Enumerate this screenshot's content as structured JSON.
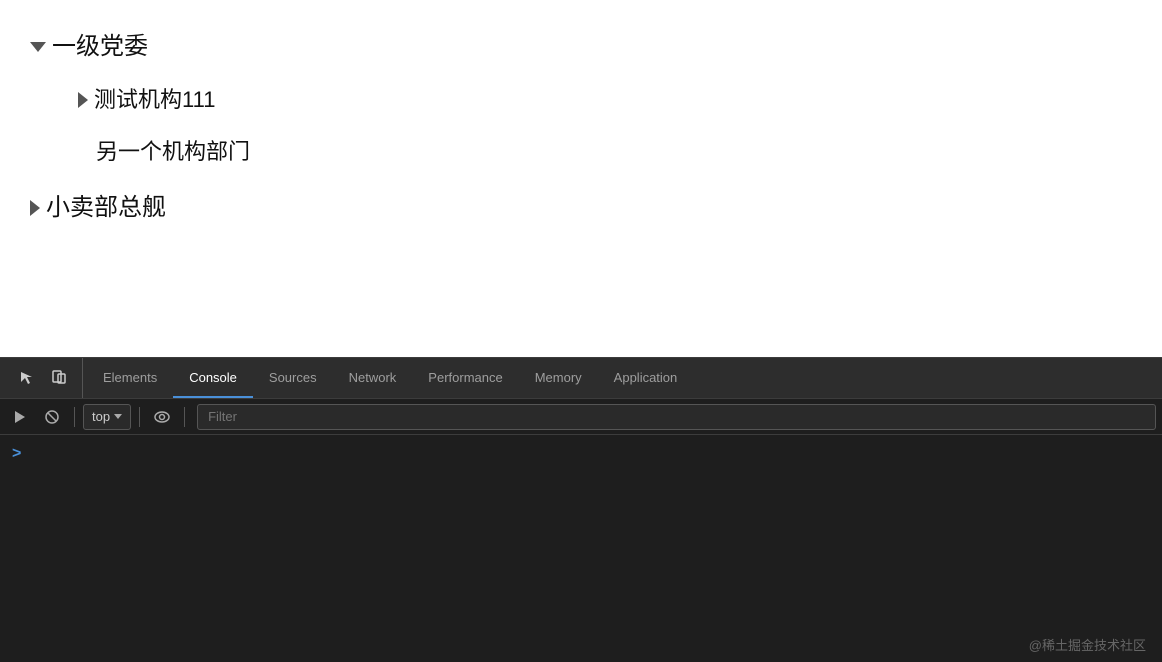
{
  "main": {
    "tree": {
      "root": {
        "label": "一级党委",
        "expanded": true,
        "children": [
          {
            "label": "测试机构111",
            "expanded": false,
            "children": []
          },
          {
            "label": "另一个机构部门",
            "expanded": false,
            "children": []
          }
        ]
      },
      "sibling": {
        "label": "小卖部总舰",
        "expanded": false
      }
    }
  },
  "devtools": {
    "tabs": [
      {
        "id": "elements",
        "label": "Elements",
        "active": false
      },
      {
        "id": "console",
        "label": "Console",
        "active": true
      },
      {
        "id": "sources",
        "label": "Sources",
        "active": false
      },
      {
        "id": "network",
        "label": "Network",
        "active": false
      },
      {
        "id": "performance",
        "label": "Performance",
        "active": false
      },
      {
        "id": "memory",
        "label": "Memory",
        "active": false
      },
      {
        "id": "application",
        "label": "Application",
        "active": false
      }
    ],
    "toolbar": {
      "top_label": "top",
      "filter_placeholder": "Filter"
    },
    "console_prompt": ">"
  },
  "watermark": {
    "text": "@稀土掘金技术社区"
  }
}
